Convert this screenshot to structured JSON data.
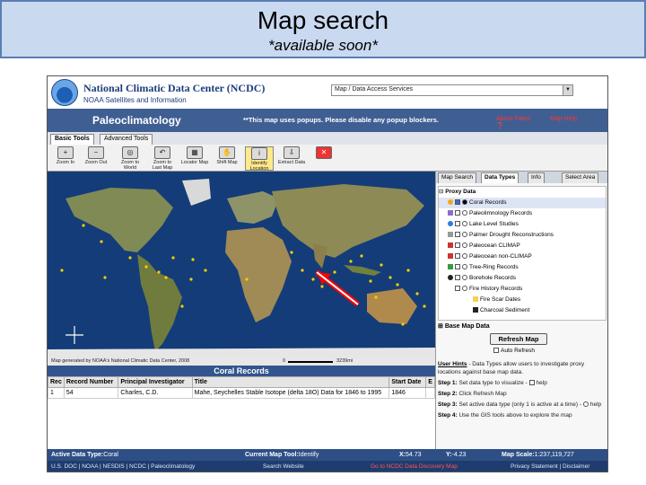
{
  "slide": {
    "title": "Map search",
    "subtitle": "*available soon*"
  },
  "banner": {
    "title": "National Climatic Data Center (NCDC)",
    "subtitle": "NOAA Satellites and Information",
    "dropdown_value": "Map / Data Access Services"
  },
  "header_bar": {
    "section_title": "Paleoclimatology",
    "popup_note": "**This map uses popups. Please disable any popup blockers.",
    "link_about": "About Paleo",
    "link_help": "Map Help"
  },
  "tool_tabs": [
    "Basic Tools",
    "Advanced Tools"
  ],
  "tools": [
    {
      "label": "Zoom In",
      "icon": "zoom-in-icon",
      "glyph": "+"
    },
    {
      "label": "Zoom Out",
      "icon": "zoom-out-icon",
      "glyph": "−"
    },
    {
      "label": "Zoom to World",
      "icon": "globe-icon",
      "glyph": "◎"
    },
    {
      "label": "Zoom to Last Map",
      "icon": "back-icon",
      "glyph": "↶"
    },
    {
      "label": "Locator Map",
      "icon": "locator-icon",
      "glyph": "▦"
    },
    {
      "label": "Shift Map",
      "icon": "hand-icon",
      "glyph": "✋"
    },
    {
      "label": "Identify Location",
      "icon": "info-icon",
      "glyph": "i"
    },
    {
      "label": "Extract Data",
      "icon": "extract-icon",
      "glyph": "⇩"
    },
    {
      "label": "",
      "icon": "clear-icon",
      "glyph": "✕"
    }
  ],
  "map": {
    "footer_credit": "Map generated by NOAA's National Climatic Data Center, 2008",
    "scale_start": "0",
    "scale_end": "3239mi"
  },
  "records": {
    "title": "Coral Records",
    "columns": [
      "Rec",
      "Record Number",
      "Principal Investigator",
      "Title",
      "Start Date",
      "E"
    ],
    "rows": [
      [
        "1",
        "54",
        "Charles, C.D.",
        "Mahe, Seychelles Stable Isotope (delta 18O) Data for 1846 to 1995",
        "1846",
        ""
      ]
    ]
  },
  "right_panel": {
    "tabs": [
      "Map Search",
      "Data Types",
      "Info",
      "Select Area"
    ],
    "active_tab": 1,
    "tree_root": "Proxy Data",
    "tree_items": [
      {
        "label": "Coral Records",
        "color": "#f5a623",
        "selected": true
      },
      {
        "label": "Paleolimnology Records",
        "color": "#8a6fd0",
        "selected": false
      },
      {
        "label": "Lake Level Studies",
        "color": "#2a7de1",
        "selected": false
      },
      {
        "label": "Palmer Drought Reconstructions",
        "color": "#999999",
        "selected": false
      },
      {
        "label": "Paleocean CLIMAP",
        "color": "#cc3333",
        "selected": false
      },
      {
        "label": "Paleocean non-CLIMAP",
        "color": "#cc3333",
        "selected": false
      },
      {
        "label": "Tree-Ring Records",
        "color": "#2f9e44",
        "selected": false
      },
      {
        "label": "Borehole Records",
        "color": "#222222",
        "selected": false
      },
      {
        "label": "Fire History Records",
        "color": "#f7d24a",
        "selected": false
      },
      {
        "label": "Fire Scar Dates",
        "color": "#f7d24a",
        "selected": false
      },
      {
        "label": "Charcoal Sediment",
        "color": "#222222",
        "selected": false
      }
    ],
    "base_map_label": "Base Map Data",
    "refresh_label": "Refresh Map",
    "auto_refresh_label": "Auto Refresh",
    "hints": {
      "heading": "User Hints",
      "intro": "- Data Types allow users to investigate proxy locations against base map data.",
      "step1_label": "Step 1:",
      "step1": "Set data type to visualize -",
      "step1_help": "help",
      "step2_label": "Step 2:",
      "step2": "Click Refresh Map",
      "step3_label": "Step 3:",
      "step3": "Set active data type (only 1 is active at a time) -",
      "step3_help": "help",
      "step4_label": "Step 4:",
      "step4": "Use the GIS tools above to explore the map"
    }
  },
  "status": {
    "active_type_label": "Active Data Type:",
    "active_type_value": "Coral Records",
    "current_tool_label": "Current Map Tool:",
    "current_tool_value": "Identify Location",
    "x_label": "X:",
    "x_value": "54.73",
    "y_label": "Y:",
    "y_value": "-4.23",
    "scale_label": "Map Scale:",
    "scale_value": "1:237,119,727"
  },
  "footer": {
    "links": "U.S. DOC | NOAA | NESDIS | NCDC | Paleoclimatology",
    "search": "Search Website",
    "discovery": "Go to NCDC Data Discovery Map",
    "privacy": "Privacy Statement | Disclaimer"
  },
  "colors": {
    "ocean": "#143c78",
    "land": "#8a8f5a",
    "header_blue": "#3f5f93",
    "marker": "#f5d000",
    "arrow": "#ff0000"
  }
}
